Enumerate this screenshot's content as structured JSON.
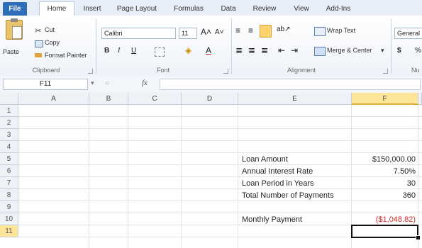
{
  "tabs": [
    "File",
    "Home",
    "Insert",
    "Page Layout",
    "Formulas",
    "Data",
    "Review",
    "View",
    "Add-Ins"
  ],
  "clipboard": {
    "paste": "Paste",
    "cut": "Cut",
    "copy": "Copy",
    "format_painter": "Format Painter",
    "label": "Clipboard"
  },
  "font": {
    "name": "Calibri",
    "size": "11",
    "bold": "B",
    "italic": "I",
    "underline": "U",
    "label": "Font"
  },
  "alignment": {
    "wrap_text": "Wrap Text",
    "merge_center": "Merge & Center",
    "label": "Alignment"
  },
  "number": {
    "format": "General",
    "currency": "$",
    "percent": "%",
    "label": "Nu"
  },
  "formula_bar": {
    "name_box": "F11",
    "fx": "fx",
    "formula": ""
  },
  "columns": [
    "A",
    "B",
    "C",
    "D",
    "E",
    "F"
  ],
  "rows": [
    "1",
    "2",
    "3",
    "4",
    "5",
    "6",
    "7",
    "8",
    "9",
    "10",
    "11"
  ],
  "selected_cell": "F11",
  "cells": {
    "E5": "Loan Amount",
    "F5": "$150,000.00",
    "E6": "Annual Interest Rate",
    "F6": "7.50%",
    "E7": "Loan Period in Years",
    "F7": "30",
    "E8": "Total Number of Payments",
    "F8": "360",
    "E10": "Monthly Payment",
    "F10": "($1,048.82)"
  },
  "colors": {
    "negative": "#d42a2a",
    "file_tab": "#2e6db8",
    "selected_header": "#fde59a"
  }
}
